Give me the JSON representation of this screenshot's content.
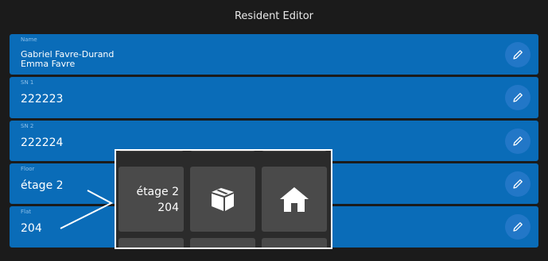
{
  "window": {
    "title": "Resident Editor"
  },
  "fields": [
    {
      "label": "Name",
      "lines": [
        "Gabriel Favre-Durand",
        "Emma Favre"
      ]
    },
    {
      "label": "SN 1",
      "value": "222223"
    },
    {
      "label": "SN 2",
      "value": "222224"
    },
    {
      "label": "Floor",
      "value": "étage 2"
    },
    {
      "label": "Flat",
      "value": "204"
    }
  ],
  "picker": {
    "selected_floor": "étage 2",
    "selected_flat": "204",
    "icons": [
      "box-icon",
      "home-icon"
    ]
  }
}
